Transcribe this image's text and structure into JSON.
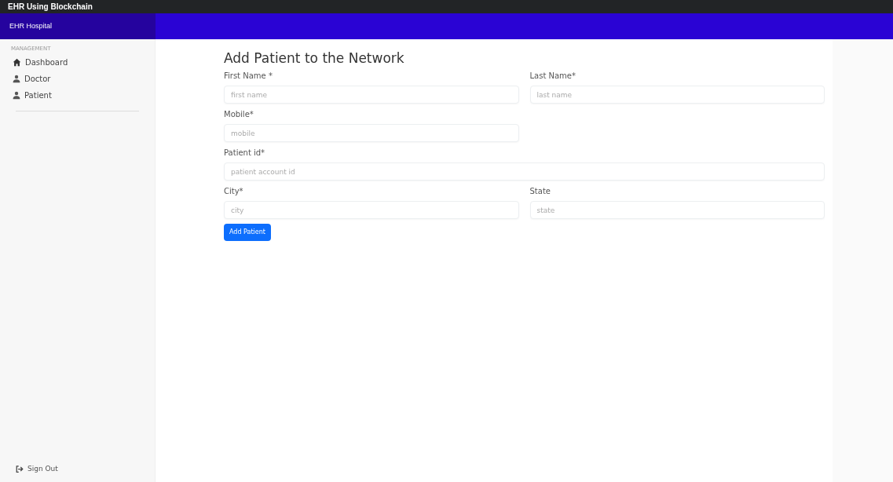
{
  "app_title": "EHR Using Blockchain",
  "hospital_name": "EHR Hospital",
  "sidebar": {
    "heading": "MANAGEMENT",
    "items": [
      {
        "label": "Dashboard",
        "kind": "home"
      },
      {
        "label": "Doctor",
        "kind": "user"
      },
      {
        "label": "Patient",
        "kind": "user"
      }
    ],
    "sign_out": "Sign Out"
  },
  "form": {
    "title": "Add Patient to the Network",
    "rows": [
      [
        {
          "label": "First Name *",
          "placeholder": "first name",
          "kind": "half"
        },
        {
          "label": "Last Name*",
          "placeholder": "last name",
          "kind": "half"
        }
      ],
      [
        {
          "label": "Mobile*",
          "placeholder": "mobile",
          "kind": "half"
        }
      ],
      [
        {
          "label": "Patient id*",
          "placeholder": "patient account id",
          "kind": "full"
        }
      ],
      [
        {
          "label": "City*",
          "placeholder": "city",
          "kind": "half"
        },
        {
          "label": "State",
          "placeholder": "state",
          "kind": "half"
        }
      ]
    ],
    "submit": "Add Patient"
  }
}
